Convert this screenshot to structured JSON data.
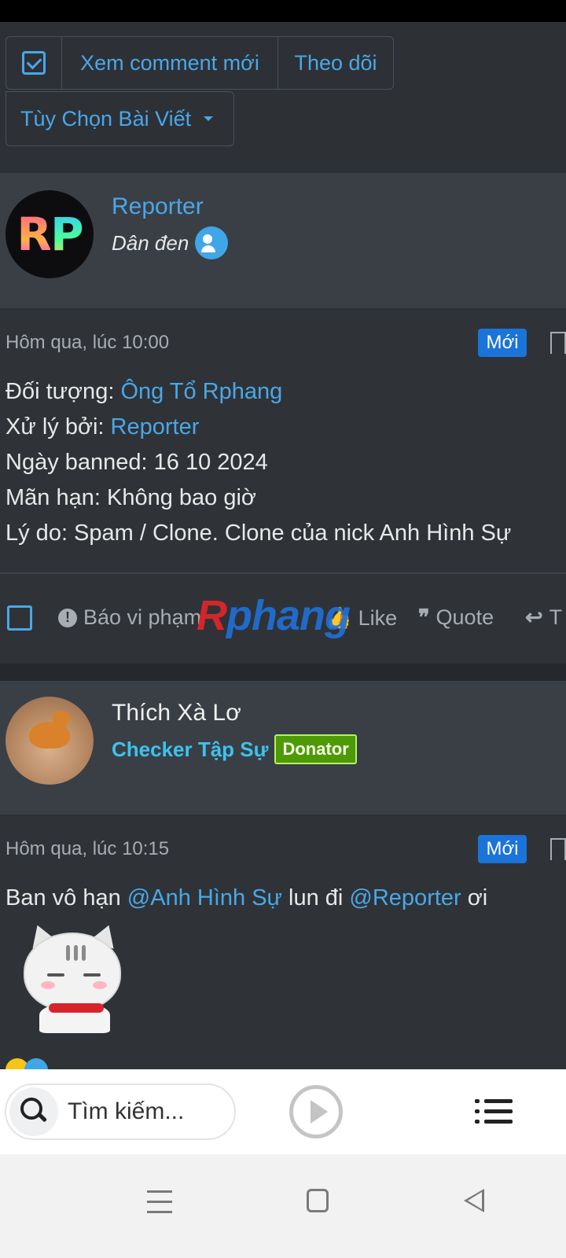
{
  "toolbar": {
    "new_comments_label": "Xem comment mới",
    "follow_label": "Theo dõi",
    "options_label": "Tùy Chọn Bài Viết"
  },
  "post1": {
    "username": "Reporter",
    "user_title": "Dân đen",
    "avatar_text_r": "R",
    "avatar_text_p": "P",
    "time": "Hôm qua, lúc 10:00",
    "badge": "Mới",
    "lines": [
      {
        "label": "Đối tượng: ",
        "link": "Ông Tổ Rphang"
      },
      {
        "label": "Xử lý bởi: ",
        "link": "Reporter"
      },
      {
        "label": "Ngày banned: 16 10 2024"
      },
      {
        "label": "Mãn hạn: Không bao giờ"
      },
      {
        "label": "Lý do: Spam / Clone. Clone của nick Anh Hình Sự"
      }
    ]
  },
  "actions": {
    "report_label": "Báo vi phạm",
    "like_label": "Like",
    "quote_label": "Quote",
    "reply_partial": "T"
  },
  "watermark": {
    "r": "R",
    "rest": "phang"
  },
  "post2": {
    "username": "Thích Xà Lơ",
    "user_title": "Checker Tập Sự",
    "badge_donator": "Donator",
    "time": "Hôm qua, lúc 10:15",
    "badge": "Mới",
    "content_prefix": "Ban vô hạn ",
    "mention1": "@Anh Hình Sự",
    "content_mid": " lun đi ",
    "mention2": "@Reporter",
    "content_suffix": " ơi"
  },
  "bottom": {
    "search_placeholder": "Tìm kiếm..."
  },
  "colors": {
    "link": "#4aa7e8",
    "badge_new": "#1b74d9",
    "donator": "#4e9a06",
    "user_title2": "#3cc3ee"
  }
}
